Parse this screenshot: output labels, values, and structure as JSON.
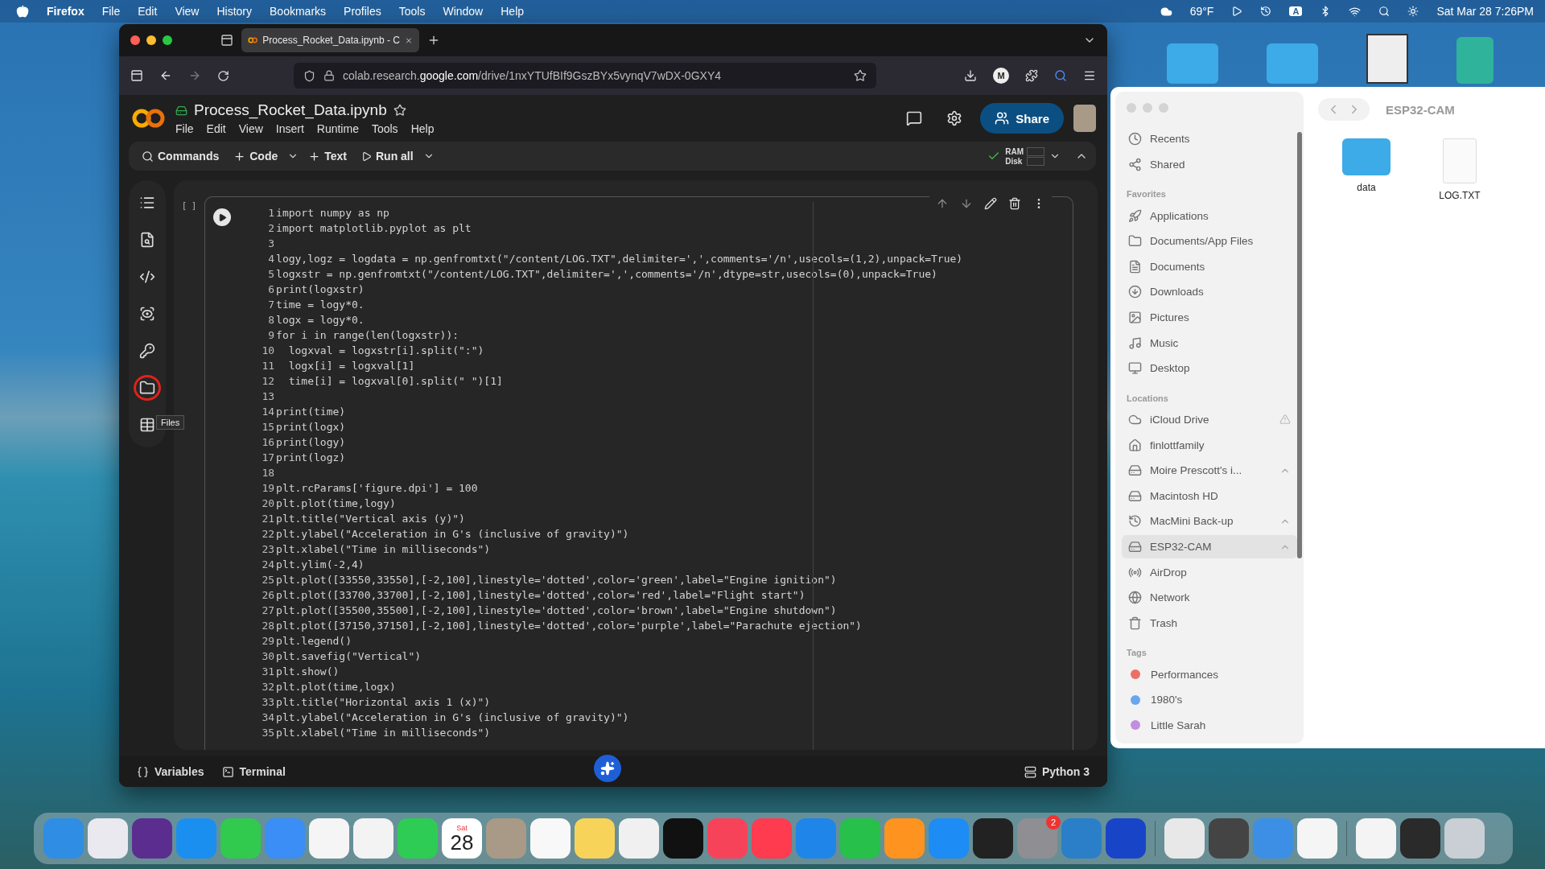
{
  "menubar": {
    "app": "Firefox",
    "menus": [
      "File",
      "Edit",
      "View",
      "History",
      "Bookmarks",
      "Profiles",
      "Tools",
      "Window",
      "Help"
    ],
    "weather": "69°F",
    "input_letter": "A",
    "clock": "Sat Mar 28  7:26PM"
  },
  "browser": {
    "tabs": [
      {
        "title": "Process_Rocket_Data.ipynb - C",
        "selected": true
      }
    ],
    "url": {
      "prefix": "colab.research.",
      "host": "google.com",
      "path": "/drive/1nxYTUfBIf9GszBYx5vynqV7wDX-0GXY4"
    },
    "profile_letter": "M"
  },
  "colab": {
    "notebook_title": "Process_Rocket_Data.ipynb",
    "menus": [
      "File",
      "Edit",
      "View",
      "Insert",
      "Runtime",
      "Tools",
      "Help"
    ],
    "share": "Share",
    "toolbar": {
      "commands": "Commands",
      "add_code": "Code",
      "add_text": "Text",
      "run_all": "Run all",
      "ram": "RAM",
      "disk": "Disk"
    },
    "rail_tooltip": "Files",
    "cell": {
      "exec_count": "[ ]",
      "lines": [
        {
          "number": "1",
          "text": "import numpy as np"
        },
        {
          "number": "2",
          "text": "import matplotlib.pyplot as plt"
        },
        {
          "number": "3"
        },
        {
          "number": "4",
          "text": "logy,logz = logdata = np.genfromtxt(\"/content/LOG.TXT\",delimiter=',',comments='/n',usecols=(1,2),unpack=True)"
        },
        {
          "number": "5",
          "text": "logxstr = np.genfromtxt(\"/content/LOG.TXT\",delimiter=',',comments='/n',dtype=str,usecols=(0),unpack=True)"
        },
        {
          "number": "6",
          "text": "print(logxstr)"
        },
        {
          "number": "7",
          "text": "time = logy*0."
        },
        {
          "number": "8",
          "text": "logx = logy*0."
        },
        {
          "number": "9",
          "text": "for i in range(len(logxstr)):"
        },
        {
          "number": "10",
          "text": "  logxval = logxstr[i].split(\":\")"
        },
        {
          "number": "11",
          "text": "  logx[i] = logxval[1]"
        },
        {
          "number": "12",
          "text": "  time[i] = logxval[0].split(\" \")[1]"
        },
        {
          "number": "13"
        },
        {
          "number": "14",
          "text": "print(time)"
        },
        {
          "number": "15",
          "text": "print(logx)"
        },
        {
          "number": "16",
          "text": "print(logy)"
        },
        {
          "number": "17",
          "text": "print(logz)"
        },
        {
          "number": "18"
        },
        {
          "number": "19",
          "text": "plt.rcParams['figure.dpi'] = 100"
        },
        {
          "number": "20",
          "text": "plt.plot(time,logy)"
        },
        {
          "number": "21",
          "text": "plt.title(\"Vertical axis (y)\")"
        },
        {
          "number": "22",
          "text": "plt.ylabel(\"Acceleration in G's (inclusive of gravity)\")"
        },
        {
          "number": "23",
          "text": "plt.xlabel(\"Time in milliseconds\")"
        },
        {
          "number": "24",
          "text": "plt.ylim(-2,4)"
        },
        {
          "number": "25",
          "text": "plt.plot([33550,33550],[-2,100],linestyle='dotted',color='green',label=\"Engine ignition\")"
        },
        {
          "number": "26",
          "text": "plt.plot([33700,33700],[-2,100],linestyle='dotted',color='red',label=\"Flight start\")"
        },
        {
          "number": "27",
          "text": "plt.plot([35500,35500],[-2,100],linestyle='dotted',color='brown',label=\"Engine shutdown\")"
        },
        {
          "number": "28",
          "text": "plt.plot([37150,37150],[-2,100],linestyle='dotted',color='purple',label=\"Parachute ejection\")"
        },
        {
          "number": "29",
          "text": "plt.legend()"
        },
        {
          "number": "30",
          "text": "plt.savefig(\"Vertical\")"
        },
        {
          "number": "31",
          "text": "plt.show()"
        },
        {
          "number": "32",
          "text": "plt.plot(time,logx)"
        },
        {
          "number": "33",
          "text": "plt.title(\"Horizontal axis 1 (x)\")"
        },
        {
          "number": "34",
          "text": "plt.ylabel(\"Acceleration in G's (inclusive of gravity)\")"
        },
        {
          "number": "35",
          "text": "plt.xlabel(\"Time in milliseconds\")"
        }
      ]
    },
    "bottom": {
      "variables": "Variables",
      "terminal": "Terminal",
      "runtime": "Python 3"
    }
  },
  "finder": {
    "title": "ESP32-CAM",
    "top_items": [
      {
        "label": "Recents",
        "selected": false
      },
      {
        "label": "Shared",
        "selected": false
      }
    ],
    "sections": [
      {
        "heading": "Favorites",
        "items": [
          {
            "label": "Applications",
            "selected": false
          },
          {
            "label": "Documents/App Files",
            "selected": false
          },
          {
            "label": "Documents",
            "selected": false
          },
          {
            "label": "Downloads",
            "selected": false
          },
          {
            "label": "Pictures",
            "selected": false
          },
          {
            "label": "Music",
            "selected": false
          },
          {
            "label": "Desktop",
            "selected": false
          }
        ]
      },
      {
        "heading": "Locations",
        "items": [
          {
            "label": "iCloud Drive",
            "selected": false,
            "ejectable": false,
            "warning": true
          },
          {
            "label": "finlottfamily",
            "selected": false,
            "ejectable": false,
            "warning": false
          },
          {
            "label": "Moire Prescott's i...",
            "selected": false,
            "ejectable": true,
            "warning": false
          },
          {
            "label": "Macintosh HD",
            "selected": false,
            "ejectable": false,
            "warning": false
          },
          {
            "label": "MacMini Back-up",
            "selected": false,
            "ejectable": true,
            "warning": false
          },
          {
            "label": "ESP32-CAM",
            "selected": true,
            "ejectable": true,
            "warning": false
          },
          {
            "label": "AirDrop",
            "selected": false,
            "ejectable": false,
            "warning": false
          },
          {
            "label": "Network",
            "selected": false,
            "ejectable": false,
            "warning": false
          },
          {
            "label": "Trash",
            "selected": false,
            "ejectable": false,
            "warning": false
          }
        ]
      }
    ],
    "tags": {
      "heading": "Tags",
      "items": [
        {
          "label": "Performances",
          "color": "#ec6f66"
        },
        {
          "label": "1980's",
          "color": "#6aa6ee"
        },
        {
          "label": "Little Sarah",
          "color": "#c38ee0"
        }
      ]
    },
    "files": [
      {
        "name": "data",
        "kind": "folder"
      },
      {
        "name": "LOG.TXT",
        "kind": "document"
      }
    ]
  },
  "dock": {
    "calendar_day": "Sat",
    "calendar_date": "28",
    "settings_badge": "2"
  }
}
